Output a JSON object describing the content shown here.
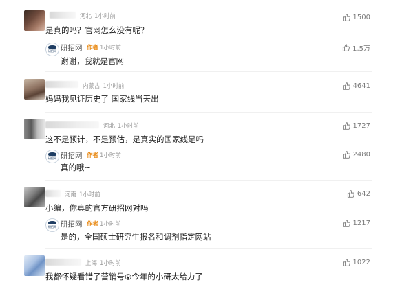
{
  "comments": [
    {
      "location": "河北",
      "time": "1小时前",
      "text": "是真的吗？官网怎么没有呢？",
      "likes": "1500",
      "reply": {
        "name": "研招网",
        "tag": "作者",
        "time": "1小时前",
        "text": "谢谢，我就是官网",
        "likes": "1.5万"
      }
    },
    {
      "location": "内蒙古",
      "time": "1小时前",
      "text": "妈妈我见证历史了 国家线当天出",
      "likes": "4641"
    },
    {
      "location": "河北",
      "time": "1小时前",
      "text": "这不是预计，不是预估，是真实的国家线是吗",
      "likes": "1727",
      "reply": {
        "name": "研招网",
        "tag": "作者",
        "time": "1小时前",
        "text": "真的哦~",
        "likes": "2480"
      }
    },
    {
      "location": "河南",
      "time": "1小时前",
      "text": "小编，你真的官方研招网对吗",
      "likes": "642",
      "reply": {
        "name": "研招网",
        "tag": "作者",
        "time": "1小时前",
        "text": "是的，全国硕士研究生报名和调剂指定网站",
        "likes": "1217"
      }
    },
    {
      "location": "上海",
      "time": "1小时前",
      "text_before": "我都怀疑看错了营销号",
      "emoji": "😮",
      "text_after": "今年的小研太给力了",
      "likes": "1022"
    }
  ],
  "logo_text": "研招网",
  "icons": {
    "like": "thumbs-up-icon"
  }
}
